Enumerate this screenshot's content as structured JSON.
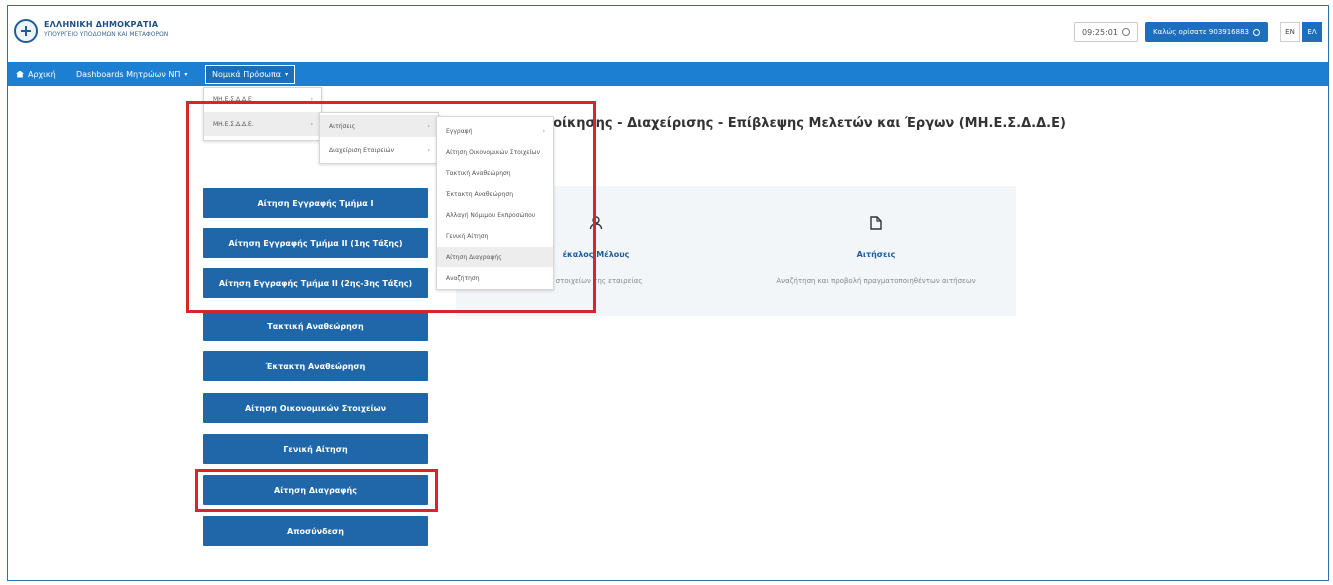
{
  "header": {
    "logo_line1": "ΕΛΛΗΝΙΚΗ ΔΗΜΟΚΡΑΤΙΑ",
    "logo_line2": "ΥΠΟΥΡΓΕΙΟ ΥΠΟΔΟΜΩΝ ΚΑΙ ΜΕΤΑΦΟΡΩΝ",
    "time": "09:25:01",
    "welcome": "Καλώς ορίσατε 903916883",
    "lang_en": "EN",
    "lang_el": "ΕΛ"
  },
  "nav": {
    "home": "Αρχική",
    "dashboards": "Dashboards Μητρώων ΝΠ",
    "legal_entities": "Νομικά Πρόσωπα"
  },
  "main": {
    "title": "ιοίκησης - Διαχείρισης - Επίβλεψης Μελετών και Έργων (ΜΗ.Ε.Σ.Δ.Δ.Ε)",
    "cards": [
      {
        "icon": "user-icon",
        "title": "έκαλος Μέλους",
        "desc": "ν στοιχείων της εταιρείας"
      },
      {
        "icon": "file-icon",
        "title": "Αιτήσεις",
        "desc": "Αναζήτηση και προβολή πραγματοποιηθέντων αιτήσεων"
      }
    ],
    "buttons": [
      "Αίτηση Εγγραφής Τμήμα Ι",
      "Αίτηση Εγγραφής Τμήμα ΙΙ (1ης Τάξης)",
      "Αίτηση Εγγραφής Τμήμα ΙΙ (2ης-3ης Τάξης)",
      "Τακτική Αναθεώρηση",
      "Έκτακτη Αναθεώρηση",
      "Αίτηση Οικονομικών Στοιχείων",
      "Γενική Αίτηση",
      "Αίτηση Διαγραφής",
      "Αποσύνδεση"
    ]
  },
  "menus": {
    "level1": [
      "ΜΗ.Ε.Σ.Δ.Δ.Ε",
      "ΜΗ.Ε.Σ.Δ.Δ.Ε."
    ],
    "level2": [
      "Αιτήσεις",
      "Διαχείριση Εταιρειών"
    ],
    "level3": [
      "Εγγραφή",
      "Αίτηση Οικονομικών Στοιχείων",
      "Τακτική Αναθεώρηση",
      "Έκτακτη Αναθεώρηση",
      "Αλλαγή Νόμιμου Εκπροσώπου",
      "Γενική Αίτηση",
      "Αίτηση Διαγραφής",
      "Αναζήτηση"
    ]
  },
  "colors": {
    "accent": "#1d7fd1",
    "button": "#1f67a9",
    "highlight": "#d9252a"
  }
}
